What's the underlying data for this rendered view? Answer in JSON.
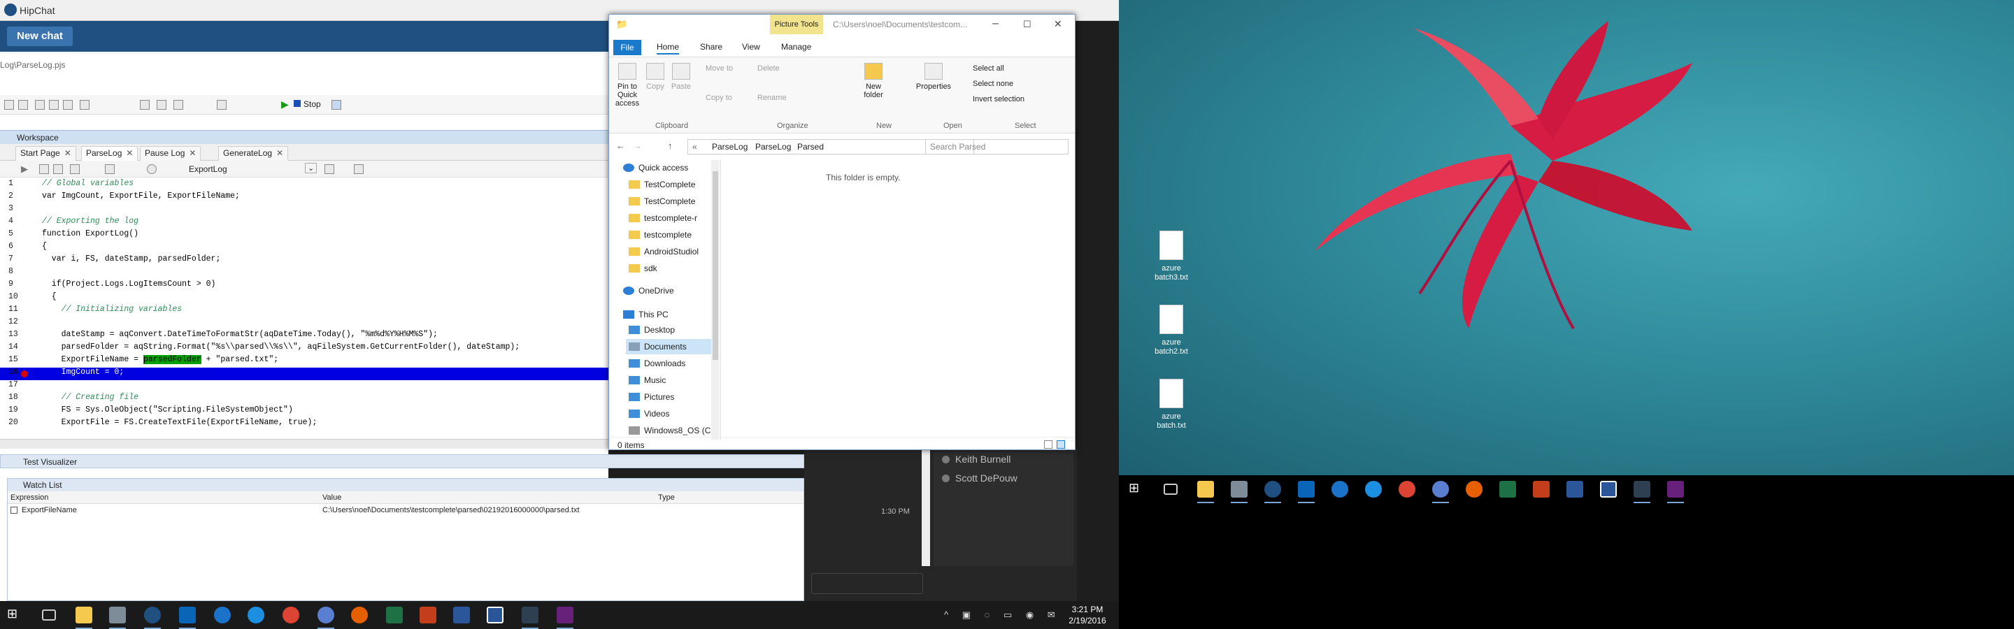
{
  "hipchat": {
    "app_title": "HipChat",
    "new_chat": "New chat",
    "people": [
      "Keith Burnell",
      "Scott DePouw"
    ],
    "message_time": "1:30 PM"
  },
  "testcomplete": {
    "file_path": "Log\\ParseLog.pjs",
    "stop_label": "Stop",
    "workspace_label": "Workspace",
    "tabs": [
      "Start Page",
      "ParseLog",
      "Pause Log",
      "GenerateLog"
    ],
    "routine": "ExportLog",
    "code_lines": [
      {
        "n": "1",
        "text": "// Global variables"
      },
      {
        "n": "2",
        "text": "var ImgCount, ExportFile, ExportFileName;"
      },
      {
        "n": "3",
        "text": ""
      },
      {
        "n": "4",
        "text": "// Exporting the log"
      },
      {
        "n": "5",
        "text": "function ExportLog()"
      },
      {
        "n": "6",
        "text": "{"
      },
      {
        "n": "7",
        "text": "  var i, FS, dateStamp, parsedFolder;"
      },
      {
        "n": "8",
        "text": ""
      },
      {
        "n": "9",
        "text": "  if(Project.Logs.LogItemsCount > 0)"
      },
      {
        "n": "10",
        "text": "  {"
      },
      {
        "n": "11",
        "text": "    // Initializing variables"
      },
      {
        "n": "12",
        "text": ""
      },
      {
        "n": "13",
        "text": "    dateStamp = aqConvert.DateTimeToFormatStr(aqDateTime.Today(), \"%m%d%Y%H%M%S\");"
      },
      {
        "n": "14",
        "text": "    parsedFolder = aqString.Format(\"%s\\\\parsed\\\\%s\\\\\", aqFileSystem.GetCurrentFolder(), dateStamp);"
      },
      {
        "n": "15",
        "text": "    ExportFileName = "
      },
      {
        "n": "16",
        "text": "    ImgCount = 0;"
      },
      {
        "n": "17",
        "text": ""
      },
      {
        "n": "18",
        "text": "    // Creating file"
      },
      {
        "n": "19",
        "text": "    FS = Sys.OleObject(\"Scripting.FileSystemObject\")"
      },
      {
        "n": "20",
        "text": "    ExportFile = FS.CreateTextFile(ExportFileName, true);"
      }
    ],
    "line15_highlight": "parsedFolder",
    "line15_tail": " + \"parsed.txt\";",
    "test_visualizer": "Test Visualizer",
    "watch_list": "Watch List",
    "watch_cols": [
      "Expression",
      "Value",
      "Type"
    ],
    "watch_row": {
      "expression": "ExportFileName",
      "value": "C:\\Users\\noel\\Documents\\testcomplete\\parsed\\02192016000000\\parsed.txt",
      "type": ""
    }
  },
  "explorer": {
    "picture_tools": "Picture Tools",
    "title_path": "C:\\Users\\noel\\Documents\\testcom...",
    "ribbon_tabs": [
      "File",
      "Home",
      "Share",
      "View",
      "Manage"
    ],
    "ribbon": {
      "pin": "Pin to Quick access",
      "copy": "Copy",
      "paste": "Paste",
      "move_to": "Move to",
      "copy_to": "Copy to",
      "delete": "Delete",
      "rename": "Rename",
      "new_folder": "New folder",
      "properties": "Properties",
      "select_all": "Select all",
      "select_none": "Select none",
      "invert_selection": "Invert selection",
      "groups": [
        "Clipboard",
        "Organize",
        "New",
        "Open",
        "Select"
      ]
    },
    "breadcrumb": [
      "ParseLog",
      "ParseLog",
      "Parsed"
    ],
    "search_placeholder": "Search Parsed",
    "nav": {
      "quick_access": "Quick access",
      "pinned": [
        "TestComplete",
        "TestComplete",
        "testcomplete-r",
        "testcomplete",
        "AndroidStudiol",
        "sdk"
      ],
      "onedrive": "OneDrive",
      "this_pc": "This PC",
      "pc_items": [
        "Desktop",
        "Documents",
        "Downloads",
        "Music",
        "Pictures",
        "Videos",
        "Windows8_OS (C:"
      ]
    },
    "empty_text": "This folder is empty.",
    "status": "0 items"
  },
  "desktop": {
    "icons": [
      "azure batch3.txt",
      "azure batch2.txt",
      "azure batch.txt"
    ]
  },
  "taskbar": {
    "time": "3:21 PM",
    "date": "2/19/2016"
  }
}
